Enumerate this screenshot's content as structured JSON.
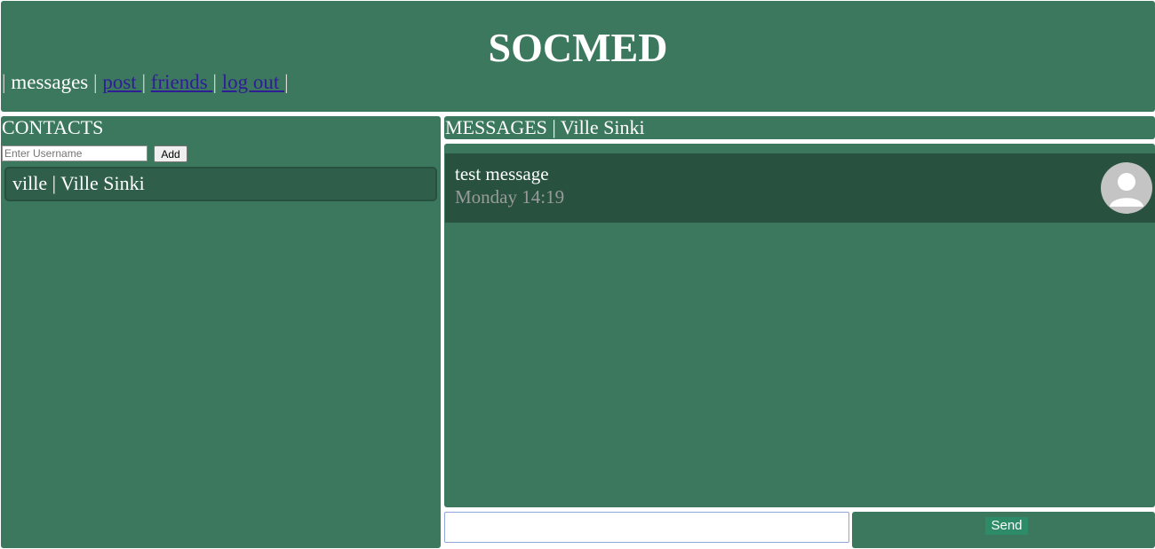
{
  "header": {
    "title": "SOCMED",
    "nav": [
      {
        "label": "messages",
        "current": true
      },
      {
        "label": "post ",
        "current": false
      },
      {
        "label": "friends ",
        "current": false
      },
      {
        "label": "log out ",
        "current": false
      }
    ],
    "separator": "|"
  },
  "contacts": {
    "title": "CONTACTS",
    "input_placeholder": "Enter Username",
    "add_label": "Add",
    "items": [
      {
        "label": "ville | Ville Sinki"
      }
    ]
  },
  "messages": {
    "title": "MESSAGES | Ville Sinki",
    "items": [
      {
        "text": "test message",
        "time": "Monday 14:19",
        "avatar_icon": "user-avatar-icon"
      }
    ],
    "input_value": "",
    "send_label": "Send"
  },
  "colors": {
    "panel": "#3c785e",
    "card": "#28523f",
    "link": "#2f1d96",
    "send": "#2e8b68"
  }
}
